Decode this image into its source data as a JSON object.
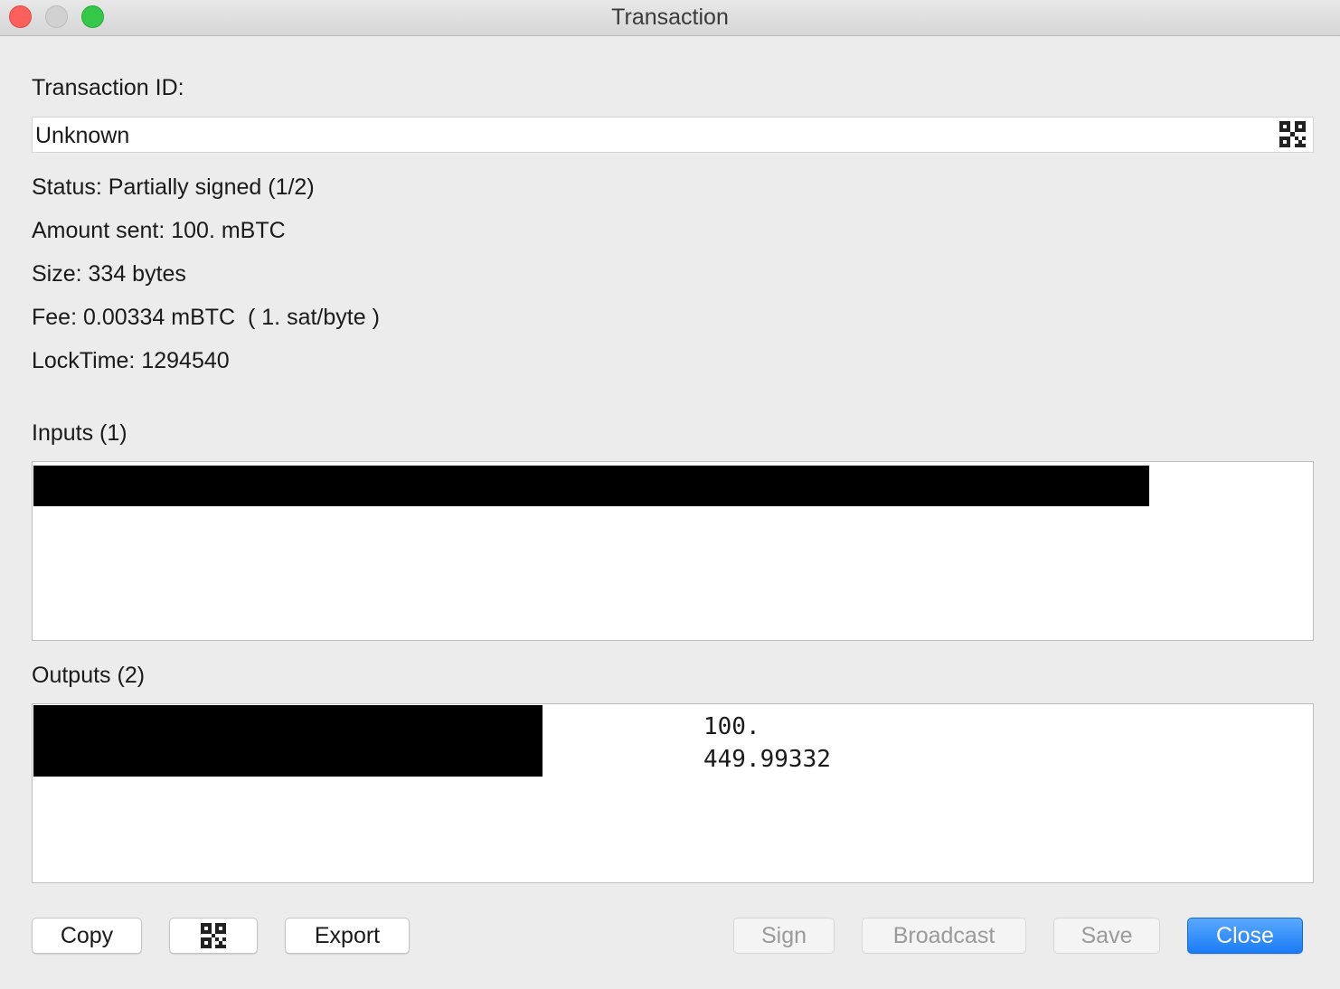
{
  "window": {
    "title": "Transaction"
  },
  "details": {
    "txid_label": "Transaction ID:",
    "txid_value": "Unknown",
    "status": "Status: Partially signed (1/2)",
    "amount_sent": "Amount sent: 100. mBTC",
    "size": "Size: 334 bytes",
    "fee": "Fee: 0.00334 mBTC  ( 1. sat/byte )",
    "locktime": "LockTime: 1294540"
  },
  "inputs": {
    "label": "Inputs (1)"
  },
  "outputs": {
    "label": "Outputs (2)",
    "rows": [
      {
        "amount": "100."
      },
      {
        "amount": "449.99332"
      }
    ]
  },
  "buttons": {
    "copy": "Copy",
    "export": "Export",
    "sign": "Sign",
    "broadcast": "Broadcast",
    "save": "Save",
    "close": "Close"
  },
  "icons": {
    "qr": "qr-code-icon"
  },
  "colors": {
    "primary_button": "#1a7cf5",
    "close_light": "#fc605c",
    "zoom_light": "#34c84a",
    "minimize_light": "#d1d1d1"
  }
}
